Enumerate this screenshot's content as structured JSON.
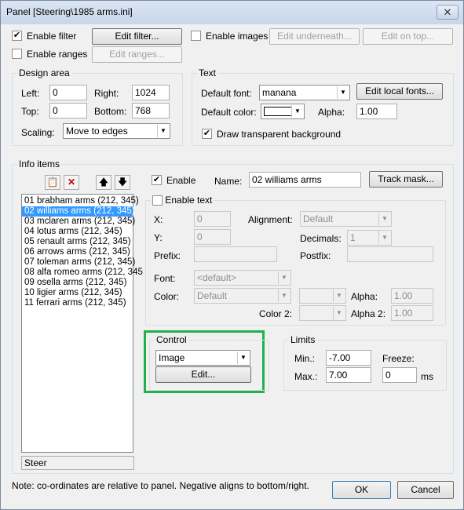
{
  "window": {
    "title": "Panel [Steering\\1985 arms.ini]",
    "close_glyph": "✕"
  },
  "top": {
    "enable_filter": "Enable filter",
    "edit_filter": "Edit filter...",
    "enable_ranges": "Enable ranges",
    "edit_ranges": "Edit ranges...",
    "enable_images": "Enable images",
    "edit_underneath": "Edit underneath...",
    "edit_on_top": "Edit on top..."
  },
  "design_area": {
    "legend": "Design area",
    "left_label": "Left:",
    "left_value": "0",
    "right_label": "Right:",
    "right_value": "1024",
    "top_label": "Top:",
    "top_value": "0",
    "bottom_label": "Bottom:",
    "bottom_value": "768",
    "scaling_label": "Scaling:",
    "scaling_value": "Move to edges"
  },
  "text_group": {
    "legend": "Text",
    "default_font_label": "Default font:",
    "default_font_value": "manana",
    "edit_local_fonts": "Edit local fonts...",
    "default_color_label": "Default color:",
    "alpha_label": "Alpha:",
    "alpha_value": "1.00",
    "draw_transparent": "Draw transparent background"
  },
  "info_items": {
    "legend": "Info items",
    "items": [
      "01 brabham arms  (212, 345)",
      "02 williams arms  (212, 345)",
      "03 mclaren arms  (212, 345)",
      "04 lotus arms  (212, 345)",
      "05 renault arms  (212, 345)",
      "06 arrows arms  (212, 345)",
      "07 toleman arms  (212, 345)",
      "08 alfa romeo arms  (212, 345",
      "09 osella arms  (212, 345)",
      "10 ligier arms  (212, 345)",
      "11 ferrari arms  (212, 345)"
    ],
    "selected_index": 1,
    "footer": "Steer",
    "enable": "Enable",
    "name_label": "Name:",
    "name_value": "02 williams arms",
    "track_mask": "Track mask...",
    "enable_text": "Enable text",
    "x_label": "X:",
    "x_value": "0",
    "y_label": "Y:",
    "y_value": "0",
    "alignment_label": "Alignment:",
    "alignment_value": "Default",
    "decimals_label": "Decimals:",
    "decimals_value": "1",
    "prefix_label": "Prefix:",
    "postfix_label": "Postfix:",
    "font_label": "Font:",
    "font_value": "<default>",
    "color_label": "Color:",
    "color_value": "Default",
    "alpha_label": "Alpha:",
    "alpha_value": "1.00",
    "color2_label": "Color 2:",
    "alpha2_label": "Alpha 2:",
    "alpha2_value": "1.00"
  },
  "control": {
    "legend": "Control",
    "type_value": "Image",
    "edit": "Edit..."
  },
  "limits": {
    "legend": "Limits",
    "min_label": "Min.:",
    "min_value": "-7.00",
    "max_label": "Max.:",
    "max_value": "7.00",
    "freeze_label": "Freeze:",
    "freeze_value": "0",
    "ms_label": "ms"
  },
  "footer": {
    "note": "Note: co-ordinates are relative to panel. Negative aligns to bottom/right.",
    "ok": "OK",
    "cancel": "Cancel"
  },
  "colors": {
    "highlight": "#3399ff",
    "control_frame": "#1fb14a"
  },
  "icons": [
    "close-icon",
    "checkmark-icon",
    "dropdown-arrow-icon",
    "add-item-icon",
    "delete-item-icon",
    "move-up-icon",
    "move-down-icon"
  ]
}
